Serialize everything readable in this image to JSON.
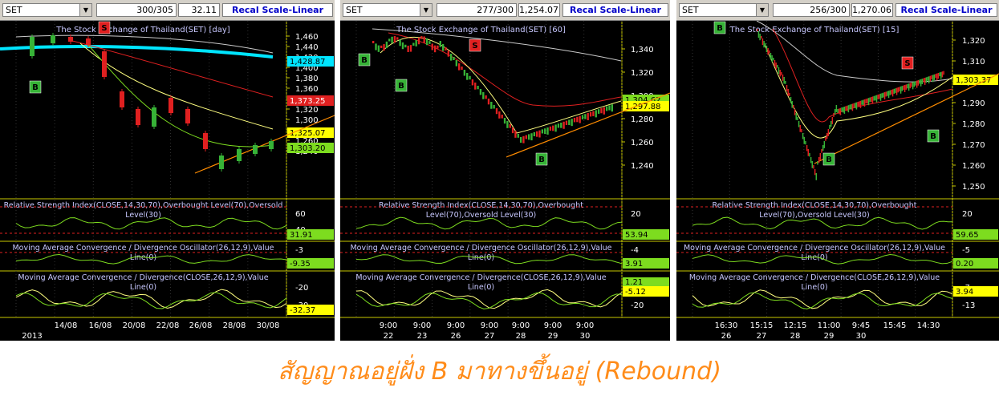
{
  "caption": "สัญญาณอยู่ฝั่ง B มาทางขึ้นอยู่ (Rebound)",
  "colors": {
    "buy": "#37b337",
    "sell": "#e02020",
    "panel_bg": "#000000",
    "axis": "#c8c800",
    "trend": "#ff8c00"
  },
  "panels": [
    {
      "symbol": "SET",
      "count": "300/305",
      "last": "32.11",
      "recal": "Recal Scale-Linear",
      "title": "The Stock Exchange of Thailand(SET) [day]",
      "rsi_title": [
        "Relative Strength Index(CLOSE,14,30,70),Overbought Level(70),Oversold",
        "Level(30)"
      ],
      "macd_osc_title": [
        "Moving Average Convergence / Divergence Oscillator(26,12,9),Value",
        "Line(0)"
      ],
      "macd_title": [
        "Moving Average Convergence / Divergence(CLOSE,26,12,9),Value",
        "Line(0)"
      ],
      "price_ticks": [
        "1,460",
        "1,440",
        "1,420",
        "1,400",
        "1,380",
        "1,360",
        "1,340",
        "1,320",
        "1,300",
        "1,280",
        "1,260",
        "1,240"
      ],
      "price_labels": [
        {
          "text": "1,428.87",
          "color": "#00e5ff"
        },
        {
          "text": "1,373.25",
          "color": "#e02020"
        },
        {
          "text": "1,325.07",
          "color": "#ffff00"
        },
        {
          "text": "1,303.20",
          "color": "#7ddc1f"
        }
      ],
      "rsi_ticks": [
        "60",
        "40"
      ],
      "rsi_value": "31.91",
      "osc_ticks": [
        "-3",
        "-15"
      ],
      "osc_value": "-9.35",
      "macd_ticks": [
        "-20",
        "-30"
      ],
      "macd_value": "-32.37",
      "x_labels": [
        "14/08",
        "16/08",
        "20/08",
        "22/08",
        "26/08",
        "28/08",
        "30/08"
      ],
      "x_sublabels": [
        "2013"
      ],
      "signals": [
        {
          "type": "B"
        },
        {
          "type": "S"
        }
      ]
    },
    {
      "symbol": "SET",
      "count": "277/300",
      "last": "1,254.07",
      "recal": "Recal Scale-Linear",
      "title": "The Stock Exchange of Thailand(SET) [60]",
      "rsi_title": [
        "Relative Strength Index(CLOSE,14,30,70),Overbought",
        "Level(70),Oversold Level(30)"
      ],
      "macd_osc_title": [
        "Moving Average Convergence / Divergence Oscillator(26,12,9),Value",
        "Line(0)"
      ],
      "macd_title": [
        "Moving Average Convergence / Divergence(CLOSE,26,12,9),Value",
        "Line(0)"
      ],
      "price_ticks": [
        "1,340",
        "1,320",
        "1,300",
        "1,280",
        "1,260",
        "1,240"
      ],
      "price_labels": [
        {
          "text": "1,304.62",
          "color": "#7ddc1f"
        },
        {
          "text": "1,297.88",
          "color": "#ffff00"
        }
      ],
      "rsi_ticks": [
        "20"
      ],
      "rsi_value": "53.94",
      "osc_ticks": [
        "-4"
      ],
      "osc_value": "3.91",
      "macd_ticks": [
        "0",
        "-20"
      ],
      "macd_value": "-5.12",
      "macd_value2": "1.21",
      "x_labels": [
        "9:00",
        "9:00",
        "9:00",
        "9:00",
        "9:00",
        "9:00",
        "9:00"
      ],
      "x_sublabels": [
        "22",
        "23",
        "26",
        "27",
        "28",
        "29",
        "30"
      ],
      "signals": [
        {
          "type": "B"
        },
        {
          "type": "B"
        },
        {
          "type": "S"
        },
        {
          "type": "B"
        }
      ]
    },
    {
      "symbol": "SET",
      "count": "256/300",
      "last": "1,270.06",
      "recal": "Recal Scale-Linear",
      "title": "The Stock Exchange of Thailand(SET) [15]",
      "rsi_title": [
        "Relative Strength Index(CLOSE,14,30,70),Overbought",
        "Level(70),Oversold Level(30)"
      ],
      "macd_osc_title": [
        "Moving Average Convergence / Divergence Oscillator(26,12,9),Value",
        "Line(0)"
      ],
      "macd_title": [
        "Moving Average Convergence / Divergence(CLOSE,26,12,9),Value",
        "Line(0)"
      ],
      "price_ticks": [
        "1,320",
        "1,310",
        "1,300",
        "1,290",
        "1,280",
        "1,270",
        "1,260",
        "1,250"
      ],
      "price_labels": [
        {
          "text": "1,303.37",
          "color": "#ffff00"
        }
      ],
      "rsi_ticks": [
        "20"
      ],
      "rsi_value": "59.65",
      "osc_ticks": [
        "-5"
      ],
      "osc_value": "0.20",
      "macd_ticks": [
        "-7",
        "-13"
      ],
      "macd_value": "3.94",
      "x_labels": [
        "16:30",
        "15:15",
        "12:15",
        "11:00",
        "9:45",
        "15:45",
        "14:30"
      ],
      "x_sublabels": [
        "26",
        "27",
        "28",
        "29",
        "30"
      ],
      "signals": [
        {
          "type": "B"
        },
        {
          "type": "B"
        },
        {
          "type": "S"
        },
        {
          "type": "B"
        }
      ]
    }
  ],
  "chart_data": [
    {
      "type": "line",
      "title": "The Stock Exchange of Thailand(SET) [day]",
      "x": [
        "14/08",
        "16/08",
        "20/08",
        "22/08",
        "26/08",
        "28/08",
        "30/08"
      ],
      "ylim": [
        1230,
        1470
      ],
      "series": [],
      "markers": [
        "B",
        "S"
      ]
    },
    {
      "type": "line",
      "title": "The Stock Exchange of Thailand(SET) [60]",
      "x": [
        "22",
        "23",
        "26",
        "27",
        "28",
        "29",
        "30"
      ],
      "ylim": [
        1230,
        1355
      ],
      "series": [],
      "markers": [
        "B",
        "B",
        "S",
        "B"
      ]
    },
    {
      "type": "line",
      "title": "The Stock Exchange of Thailand(SET) [15]",
      "x": [
        "26",
        "27",
        "28",
        "29",
        "30"
      ],
      "ylim": [
        1243,
        1330
      ],
      "series": [],
      "markers": [
        "B",
        "B",
        "S",
        "B"
      ]
    }
  ]
}
